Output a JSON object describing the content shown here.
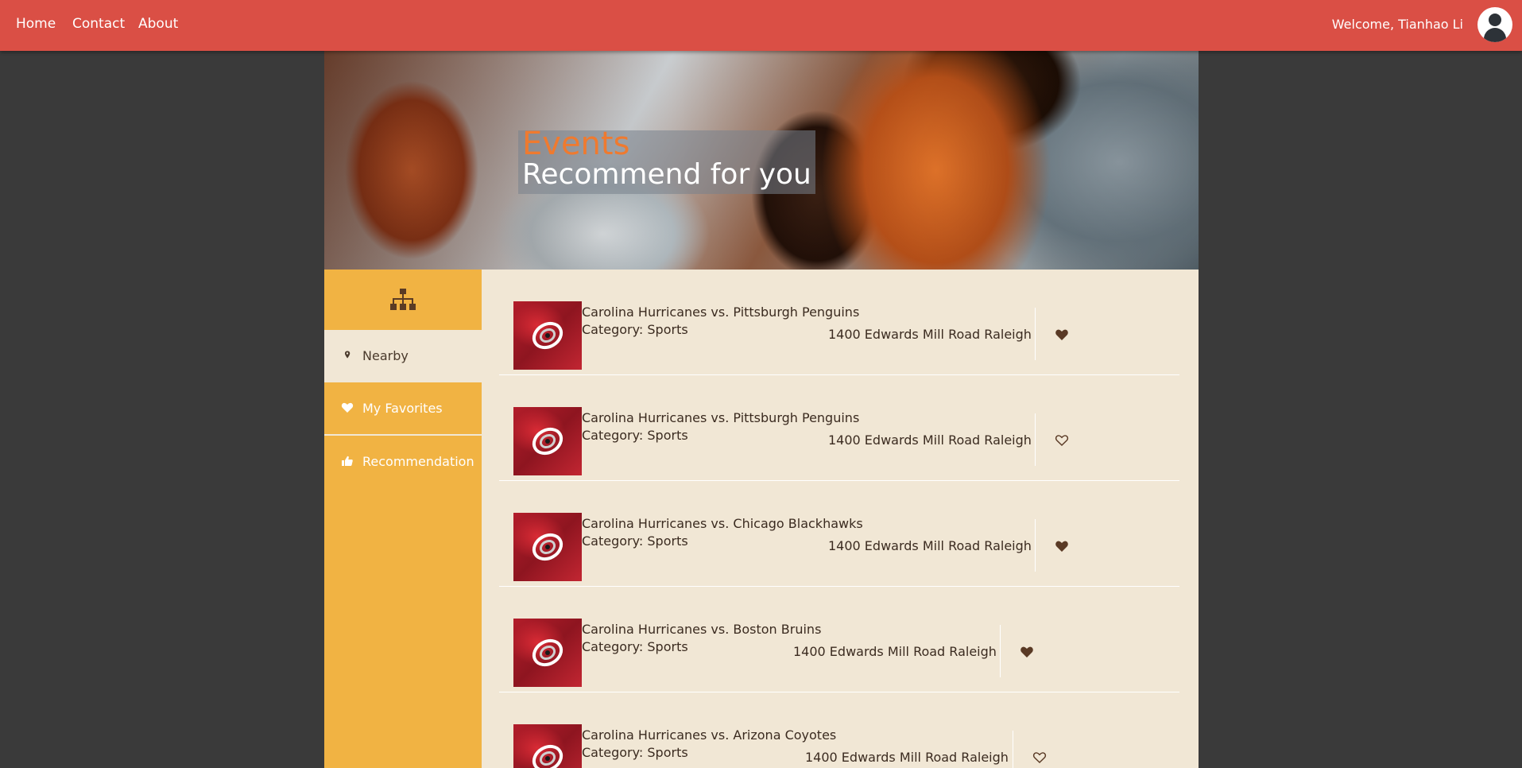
{
  "nav": {
    "links": [
      "Home",
      "Contact",
      "About"
    ],
    "welcome": "Welcome, Tianhao Li"
  },
  "hero": {
    "title": "Events",
    "subtitle": "Recommend for you"
  },
  "sidebar": {
    "items": [
      {
        "label": "Nearby",
        "icon": "map-marker-icon",
        "active": true
      },
      {
        "label": "My Favorites",
        "icon": "heart-icon",
        "active": false
      },
      {
        "label": "Recommendation",
        "icon": "thumbs-up-icon",
        "active": false
      }
    ]
  },
  "events": [
    {
      "title": "Carolina Hurricanes vs. Pittsburgh Penguins",
      "category": "Category: Sports",
      "address": "1400 Edwards Mill Road Raleigh",
      "favorite": true
    },
    {
      "title": "Carolina Hurricanes vs. Pittsburgh Penguins",
      "category": "Category: Sports",
      "address": "1400 Edwards Mill Road Raleigh",
      "favorite": false
    },
    {
      "title": "Carolina Hurricanes vs. Chicago Blackhawks",
      "category": "Category: Sports",
      "address": "1400 Edwards Mill Road Raleigh",
      "favorite": true
    },
    {
      "title": "Carolina Hurricanes vs. Boston Bruins",
      "category": "Category: Sports",
      "address": "1400 Edwards Mill Road Raleigh",
      "favorite": true
    },
    {
      "title": "Carolina Hurricanes vs. Arizona Coyotes",
      "category": "Category: Sports",
      "address": "1400 Edwards Mill Road Raleigh",
      "favorite": false
    }
  ],
  "colors": {
    "nav_bg": "#da4f45",
    "sidebar_bg": "#f1b343",
    "content_bg": "#f1e7d5",
    "page_bg": "#3a3a3a",
    "title_accent": "#ef7a2f",
    "text_dark": "#3b2b20"
  }
}
